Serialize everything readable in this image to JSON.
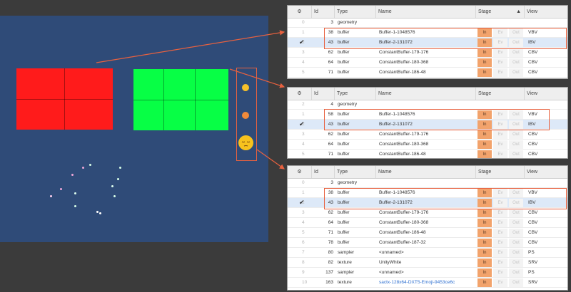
{
  "colors": {
    "viewport_bg": "#2f4b78",
    "red_mesh": "#ff1b1b",
    "green_mesh": "#07ff45",
    "highlight": "#e8613f",
    "stage_in": "#f2a36c",
    "link": "#2d6fd0"
  },
  "emojis": [
    {
      "name": "small-smiley",
      "color": "#f6c02a"
    },
    {
      "name": "small-pouting-face",
      "color": "#f08a3a"
    },
    {
      "name": "pensive-face",
      "color": "#f7c21d"
    }
  ],
  "panels": [
    {
      "columns": {
        "icon": "gear-icon",
        "id": "Id",
        "type": "Type",
        "name": "Name",
        "stage": "Stage",
        "sort": "▲",
        "view": "View"
      },
      "stage_labels": [
        "In",
        "Ev",
        "Out"
      ],
      "rows": [
        {
          "idx": "0",
          "id": "3",
          "type": "geometry",
          "name": "",
          "stage": false,
          "view": "",
          "check": false
        },
        {
          "idx": "1",
          "id": "38",
          "type": "buffer",
          "name": "Buffer-1-1048576",
          "stage": true,
          "view": "VBV",
          "check": false
        },
        {
          "idx": "2",
          "id": "43",
          "type": "buffer",
          "name": "Buffer-2-131072",
          "stage": true,
          "view": "IBV",
          "check": true
        },
        {
          "idx": "3",
          "id": "62",
          "type": "buffer",
          "name": "ConstantBuffer-179-176",
          "stage": true,
          "view": "CBV",
          "check": false
        },
        {
          "idx": "4",
          "id": "64",
          "type": "buffer",
          "name": "ConstantBuffer-180-368",
          "stage": true,
          "view": "CBV",
          "check": false
        },
        {
          "idx": "5",
          "id": "71",
          "type": "buffer",
          "name": "ConstantBuffer-186-48",
          "stage": true,
          "view": "CBV",
          "check": false
        }
      ]
    },
    {
      "columns": {
        "icon": "gear-icon",
        "id": "Id",
        "type": "Type",
        "name": "Name",
        "stage": "Stage",
        "sort": "",
        "view": "View"
      },
      "stage_labels": [
        "In",
        "Ev",
        "Out"
      ],
      "rows": [
        {
          "idx": "2",
          "id": "4",
          "type": "geometry",
          "name": "",
          "stage": false,
          "view": "",
          "check": false
        },
        {
          "idx": "1",
          "id": "58",
          "type": "buffer",
          "name": "Buffer-1-1048576",
          "stage": true,
          "view": "VBV",
          "check": false
        },
        {
          "idx": "2",
          "id": "43",
          "type": "buffer",
          "name": "Buffer-2-131072",
          "stage": true,
          "view": "IBV",
          "check": true
        },
        {
          "idx": "3",
          "id": "62",
          "type": "buffer",
          "name": "ConstantBuffer-179-176",
          "stage": true,
          "view": "CBV",
          "check": false
        },
        {
          "idx": "4",
          "id": "64",
          "type": "buffer",
          "name": "ConstantBuffer-180-368",
          "stage": true,
          "view": "CBV",
          "check": false
        },
        {
          "idx": "5",
          "id": "71",
          "type": "buffer",
          "name": "ConstantBuffer-186-48",
          "stage": true,
          "view": "CBV",
          "check": false
        }
      ]
    },
    {
      "columns": {
        "icon": "gear-icon",
        "id": "Id",
        "type": "Type",
        "name": "Name",
        "stage": "Stage",
        "sort": "",
        "view": "View"
      },
      "stage_labels": [
        "In",
        "Ev",
        "Out"
      ],
      "rows": [
        {
          "idx": "0",
          "id": "3",
          "type": "geometry",
          "name": "",
          "stage": false,
          "view": "",
          "check": false
        },
        {
          "idx": "1",
          "id": "38",
          "type": "buffer",
          "name": "Buffer-1-1048576",
          "stage": true,
          "view": "VBV",
          "check": false
        },
        {
          "idx": "2",
          "id": "43",
          "type": "buffer",
          "name": "Buffer-2-131072",
          "stage": true,
          "view": "IBV",
          "check": true
        },
        {
          "idx": "3",
          "id": "62",
          "type": "buffer",
          "name": "ConstantBuffer-179-176",
          "stage": true,
          "view": "CBV",
          "check": false
        },
        {
          "idx": "4",
          "id": "64",
          "type": "buffer",
          "name": "ConstantBuffer-180-368",
          "stage": true,
          "view": "CBV",
          "check": false
        },
        {
          "idx": "5",
          "id": "71",
          "type": "buffer",
          "name": "ConstantBuffer-186-48",
          "stage": true,
          "view": "CBV",
          "check": false
        },
        {
          "idx": "6",
          "id": "78",
          "type": "buffer",
          "name": "ConstantBuffer-187-32",
          "stage": true,
          "view": "CBV",
          "check": false
        },
        {
          "idx": "7",
          "id": "80",
          "type": "sampler",
          "name": "<unnamed>",
          "stage": true,
          "view": "PS",
          "check": false
        },
        {
          "idx": "8",
          "id": "82",
          "type": "texture",
          "name": "UnityWhite",
          "stage": true,
          "view": "SRV",
          "check": false
        },
        {
          "idx": "9",
          "id": "137",
          "type": "sampler",
          "name": "<unnamed>",
          "stage": true,
          "view": "PS",
          "check": false
        },
        {
          "idx": "10",
          "id": "163",
          "type": "texture",
          "name": "sactx-128x64-DXT5-Emoji-9453ce6c",
          "stage": true,
          "view": "SRV",
          "check": false,
          "link": true
        }
      ]
    }
  ]
}
